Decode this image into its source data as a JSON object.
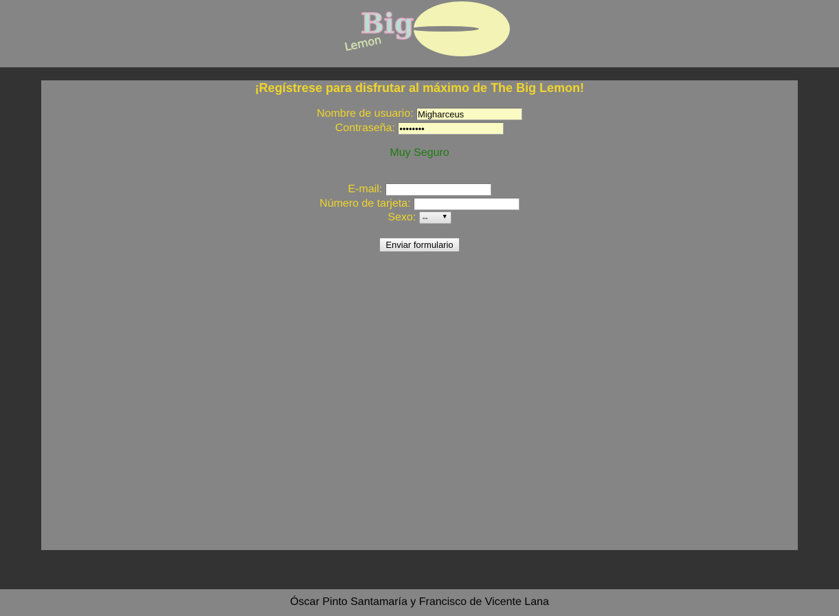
{
  "header": {
    "logo_name": "big-lemon-logo",
    "logo_text_big": "Big",
    "logo_text_lemon": "Lemon"
  },
  "form": {
    "title": "¡Regístrese para disfrutar al máximo de The Big Lemon!",
    "username_label": "Nombre de usuario:",
    "username_value": "Migharceus",
    "password_label": "Contraseña:",
    "password_value": "••••••••",
    "password_strength": "Muy Seguro",
    "email_label": "E-mail:",
    "email_value": "",
    "card_label": "Número de tarjeta:",
    "card_value": "",
    "sex_label": "Sexo:",
    "sex_selected": "--",
    "submit_label": "Enviar formulario"
  },
  "footer": {
    "credits": "Óscar Pinto Santamaría y Francisco de Vicente Lana"
  },
  "colors": {
    "page_background": "#333333",
    "panel_background": "#858585",
    "label_text": "#f0d52b",
    "strength_text": "#1f7a12",
    "filled_input": "#fafbc2"
  }
}
